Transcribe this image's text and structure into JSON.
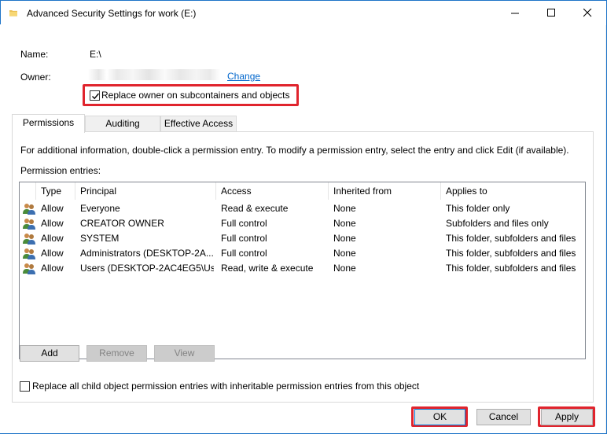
{
  "window": {
    "title": "Advanced Security Settings for work (E:)"
  },
  "details": {
    "name_label": "Name:",
    "name_value": "E:\\",
    "owner_label": "Owner:",
    "change_link": "Change",
    "replace_owner_label": "Replace owner on subcontainers and objects",
    "replace_owner_checked": true
  },
  "tabs": [
    {
      "label": "Permissions",
      "active": true
    },
    {
      "label": "Auditing",
      "active": false
    },
    {
      "label": "Effective Access",
      "active": false
    }
  ],
  "permissions": {
    "info_text": "For additional information, double-click a permission entry. To modify a permission entry, select the entry and click Edit (if available).",
    "entries_label": "Permission entries:",
    "columns": [
      "Type",
      "Principal",
      "Access",
      "Inherited from",
      "Applies to"
    ],
    "rows": [
      [
        "Allow",
        "Everyone",
        "Read & execute",
        "None",
        "This folder only"
      ],
      [
        "Allow",
        "CREATOR OWNER",
        "Full control",
        "None",
        "Subfolders and files only"
      ],
      [
        "Allow",
        "SYSTEM",
        "Full control",
        "None",
        "This folder, subfolders and files"
      ],
      [
        "Allow",
        "Administrators (DESKTOP-2A...",
        "Full control",
        "None",
        "This folder, subfolders and files"
      ],
      [
        "Allow",
        "Users (DESKTOP-2AC4EG5\\Us...",
        "Read, write & execute",
        "None",
        "This folder, subfolders and files"
      ]
    ],
    "add_button": "Add",
    "remove_button": "Remove",
    "view_button": "View",
    "replace_child_label": "Replace all child object permission entries with inheritable permission entries from this object"
  },
  "footer": {
    "ok": "OK",
    "cancel": "Cancel",
    "apply": "Apply"
  },
  "colors": {
    "highlight": "#e0242d",
    "link": "#0066cc",
    "accent": "#1e74c8"
  }
}
